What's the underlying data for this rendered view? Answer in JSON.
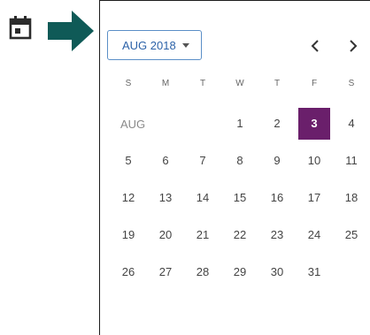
{
  "picker": {
    "month_button": "AUG 2018",
    "month_label": "AUG",
    "weekdays": [
      "S",
      "M",
      "T",
      "W",
      "T",
      "F",
      "S"
    ],
    "selected_day": "3",
    "accent_color": "#6a1f6b",
    "arrow_color": "#0f5a57"
  },
  "weeks": [
    [
      "",
      "",
      "",
      "1",
      "2",
      "3",
      "4"
    ],
    [
      "5",
      "6",
      "7",
      "8",
      "9",
      "10",
      "11"
    ],
    [
      "12",
      "13",
      "14",
      "15",
      "16",
      "17",
      "18"
    ],
    [
      "19",
      "20",
      "21",
      "22",
      "23",
      "24",
      "25"
    ],
    [
      "26",
      "27",
      "28",
      "29",
      "30",
      "31",
      ""
    ]
  ]
}
